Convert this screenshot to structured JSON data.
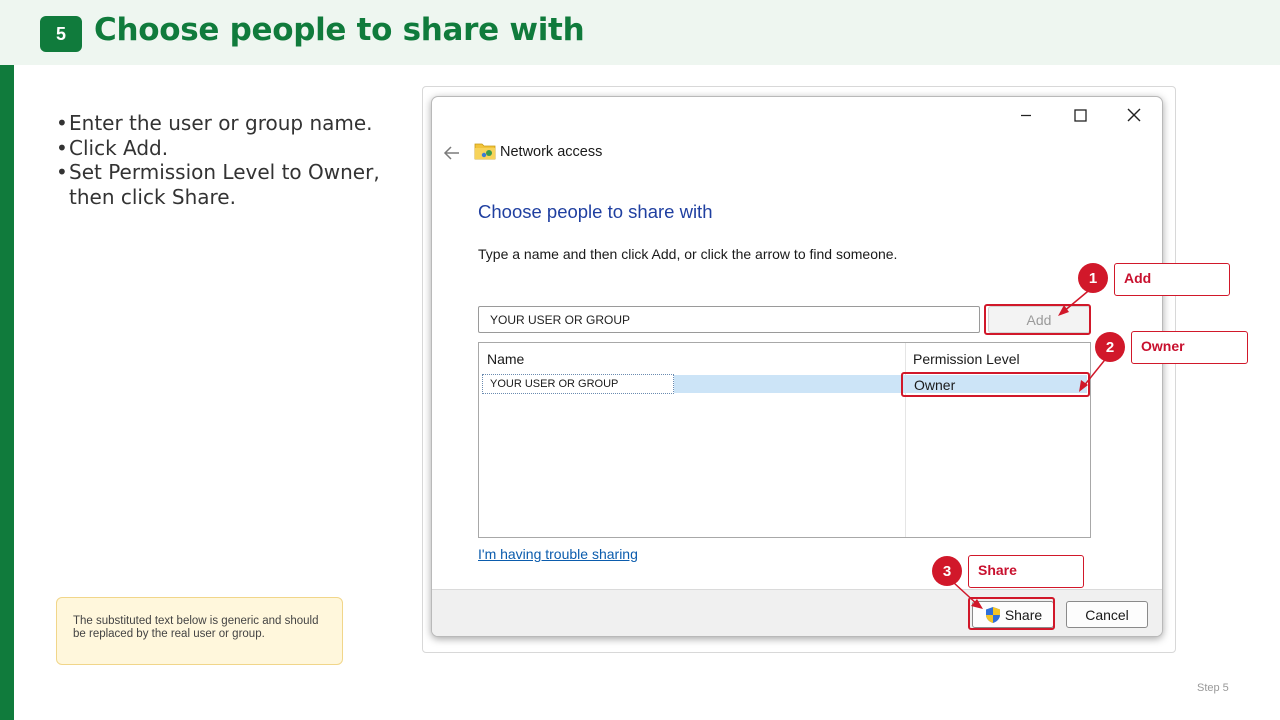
{
  "slide": {
    "step_number": "5",
    "title": "Choose people to share with",
    "bullets": [
      "Enter the user or group name.",
      "Click Add.",
      "Set Permission Level to Owner, then click Share."
    ],
    "note": "The substituted text below is generic and should be replaced by the real user or group.",
    "footer": "Step 5",
    "accent_color": "#107b3c",
    "callout_color": "#d1182a"
  },
  "dialog": {
    "window_title": "Network access",
    "window_icon": "shared-folder-icon",
    "heading": "Choose people to share with",
    "instruction": "Type a name and then click Add, or click the arrow to find someone.",
    "name_input_value": "YOUR USER OR GROUP",
    "add_button": "Add",
    "columns": {
      "name": "Name",
      "permission": "Permission Level"
    },
    "rows": [
      {
        "name": "YOUR USER OR GROUP",
        "permission": "Owner"
      }
    ],
    "trouble_link": "I'm having trouble sharing",
    "share_button": "Share",
    "cancel_button": "Cancel"
  },
  "callouts": [
    {
      "number": "1",
      "label": "Add"
    },
    {
      "number": "2",
      "label": "Owner"
    },
    {
      "number": "3",
      "label": "Share"
    }
  ]
}
